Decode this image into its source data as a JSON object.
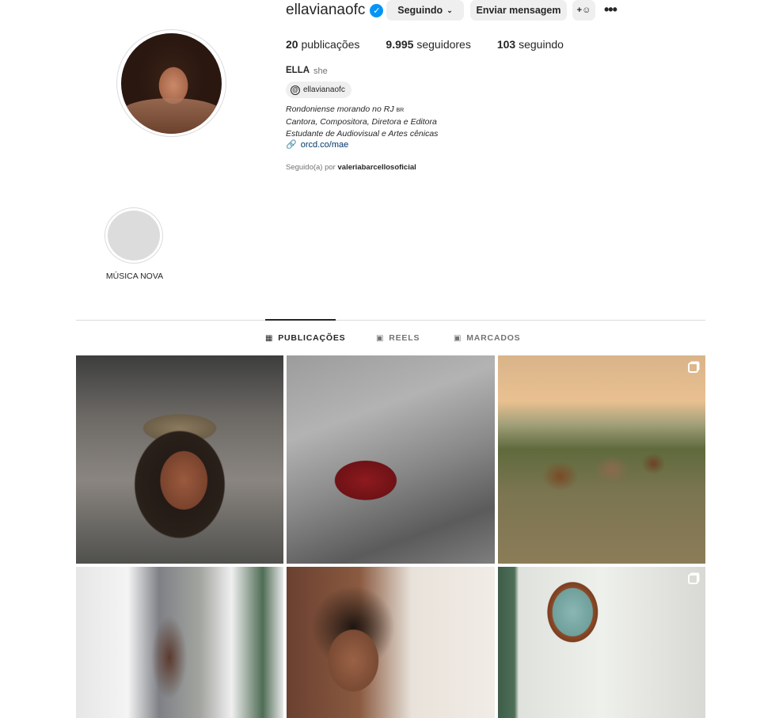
{
  "profile": {
    "username": "ellavianaofc",
    "following_button": "Seguindo",
    "message_button": "Enviar mensagem",
    "stats": {
      "posts_count": "20",
      "posts_label": "publicações",
      "followers_count": "9.995",
      "followers_label": "seguidores",
      "following_count": "103",
      "following_label": "seguindo"
    },
    "full_name": "ELLA",
    "pronoun": "she",
    "threads_handle": "ellavianaofc",
    "bio_lines": [
      "Rondoniense morando no RJ",
      "Cantora, Compositora, Diretora e Editora",
      "Estudante de Audiovisual e Artes cênicas"
    ],
    "bio_flag_text": "BR",
    "link": "orcd.co/mae",
    "followed_by_prefix": "Seguido(a) por",
    "followed_by_user": "valeriabarcellosoficial"
  },
  "highlights": [
    {
      "label": "MÚSICA NOVA"
    }
  ],
  "tabs": [
    {
      "label": "PUBLICAÇÕES",
      "active": true,
      "icon": "grid-icon"
    },
    {
      "label": "REELS",
      "active": false,
      "icon": "reels-icon"
    },
    {
      "label": "MARCADOS",
      "active": false,
      "icon": "tagged-icon"
    }
  ],
  "posts": [
    {
      "id": "post-1",
      "multiple": false
    },
    {
      "id": "post-2",
      "multiple": false
    },
    {
      "id": "post-3",
      "multiple": true
    },
    {
      "id": "post-4",
      "multiple": false
    },
    {
      "id": "post-5",
      "multiple": false
    },
    {
      "id": "post-6",
      "multiple": true
    }
  ],
  "colors": {
    "verified": "#0095f6",
    "button_bg": "#efefef",
    "link": "#00376b",
    "muted": "#737373"
  }
}
